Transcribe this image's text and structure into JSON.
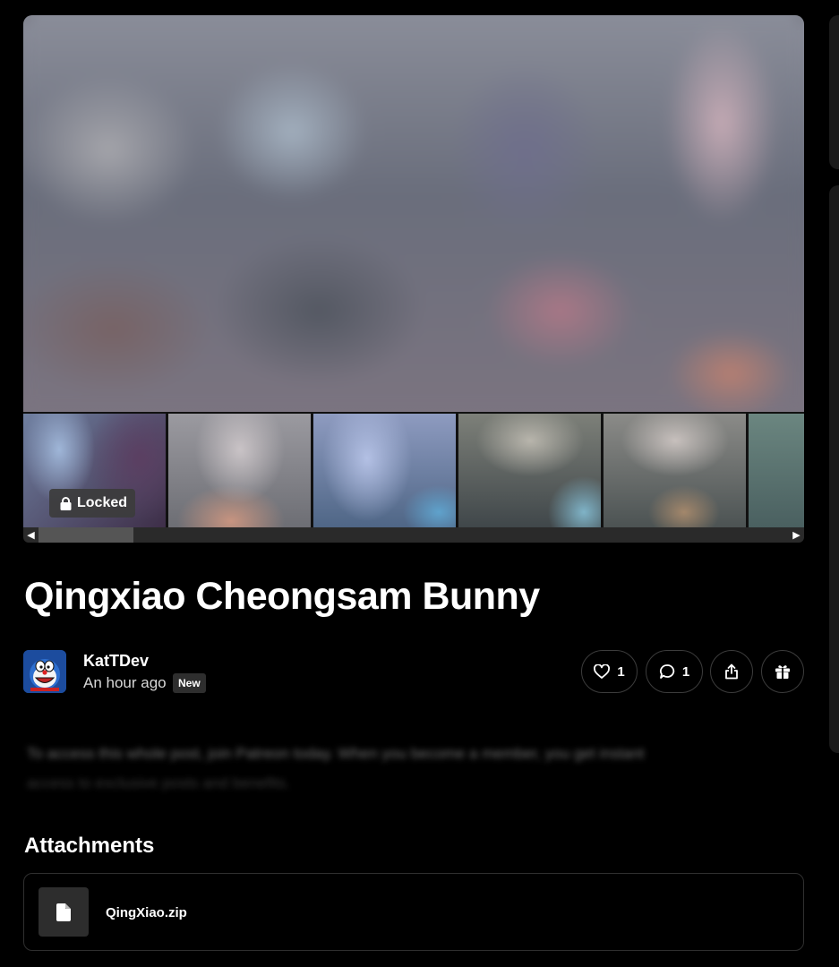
{
  "gallery": {
    "locked_label": "Locked",
    "thumbnail_count": 6
  },
  "post": {
    "title": "Qingxiao Cheongsam Bunny"
  },
  "author": {
    "name": "KatTDev",
    "time": "An hour ago",
    "badge": "New"
  },
  "actions": {
    "like_count": "1",
    "comment_count": "1"
  },
  "teaser": {
    "line1": "To access this whole post, join Patreon today. When you become a member, you get instant",
    "line2": "access to exclusive posts and benefits."
  },
  "attachments": {
    "heading": "Attachments",
    "files": [
      {
        "name": "QingXiao.zip"
      }
    ]
  },
  "icons": {
    "lock": "lock-icon",
    "heart": "heart-icon",
    "comment": "comment-icon",
    "share": "share-icon",
    "gift": "gift-icon",
    "file": "file-icon"
  },
  "colors": {
    "background": "#000000",
    "card_border": "#2f2f2f",
    "badge_bg": "#2e2e2e"
  }
}
